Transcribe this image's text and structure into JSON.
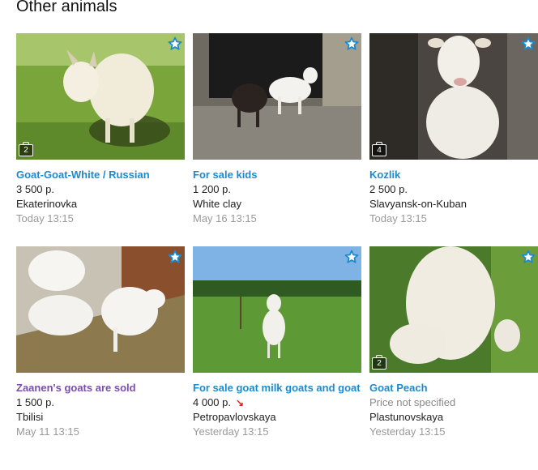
{
  "section_title": "Other animals",
  "listings": [
    {
      "title": "Goat-Goat-White / Russian",
      "price": "3 500 p.",
      "location": "Ekaterinovka",
      "date": "Today 13:15",
      "photos": "2",
      "visited": false
    },
    {
      "title": "For sale kids",
      "price": "1 200 p.",
      "location": "White clay",
      "date": "May 16 13:15",
      "photos": "",
      "visited": false
    },
    {
      "title": "Kozlik",
      "price": "2 500 p.",
      "location": "Slavyansk-on-Kuban",
      "date": "Today 13:15",
      "photos": "4",
      "visited": false
    },
    {
      "title": "Zaanen's goats are sold",
      "price": "1 500 p.",
      "location": "Tbilisi",
      "date": "May 11 13:15",
      "photos": "",
      "visited": true
    },
    {
      "title": "For sale goat milk goats and goat",
      "price": "4 000 p.",
      "location": "Petropavlovskaya",
      "date": "Yesterday 13:15",
      "photos": "",
      "visited": false,
      "price_down": true
    },
    {
      "title": "Goat Peach",
      "price": "Price not specified",
      "location": "Plastunovskaya",
      "date": "Yesterday 13:15",
      "photos": "2",
      "visited": false,
      "no_price": true
    }
  ],
  "colors": {
    "link": "#1a8bd1",
    "visited": "#7b4cb3",
    "muted": "#999999",
    "star": "#1a8bd1"
  }
}
